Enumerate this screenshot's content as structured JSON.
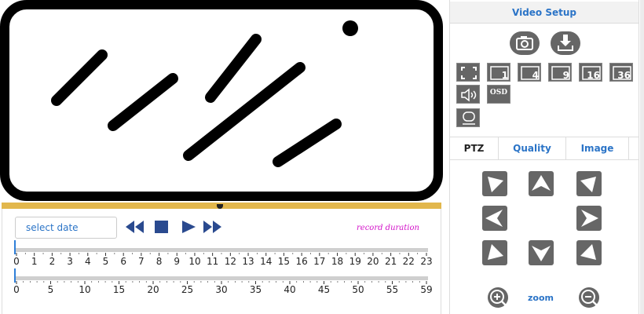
{
  "playback": {
    "date_placeholder": "select date",
    "record_duration_label": "record duration",
    "hours_ticks": [
      "0",
      "1",
      "2",
      "3",
      "4",
      "5",
      "6",
      "7",
      "8",
      "9",
      "10",
      "11",
      "12",
      "13",
      "14",
      "15",
      "16",
      "17",
      "18",
      "19",
      "20",
      "21",
      "22",
      "23"
    ],
    "minutes_ticks": [
      "0",
      "5",
      "10",
      "15",
      "20",
      "25",
      "30",
      "35",
      "40",
      "45",
      "50",
      "55",
      "59"
    ]
  },
  "side": {
    "title": "Video Setup",
    "layout_buttons": [
      "1",
      "4",
      "9",
      "16",
      "36"
    ],
    "osd_label": "OSD",
    "tabs": [
      "PTZ",
      "Quality",
      "Image"
    ],
    "zoom_label": "zoom"
  },
  "icons": {
    "snapshot": "camera-icon",
    "record": "download-icon",
    "fullscreen": "fullscreen-icon",
    "audio": "speaker-icon",
    "talk": "chat-icon",
    "rewind": "rewind-icon",
    "stop": "stop-icon",
    "play": "play-icon",
    "fast_forward": "fast-forward-icon"
  },
  "colors": {
    "accent_blue": "#2b74c7",
    "record_duration": "#d312c9",
    "divider": "#e2b74c",
    "button_gray": "#666666"
  }
}
